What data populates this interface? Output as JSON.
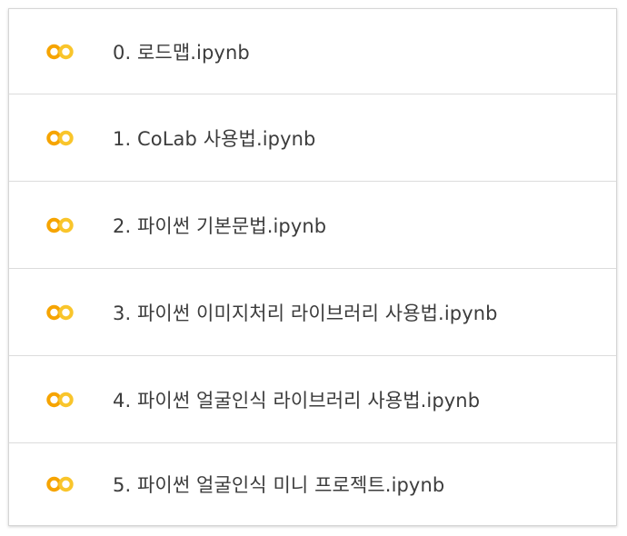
{
  "file_list": {
    "icon": "colab-icon",
    "colors": {
      "icon_orange": "#f6a400",
      "icon_yellow": "#f9c52b",
      "text": "#3c3c3c",
      "divider": "#dcdcdc"
    },
    "items": [
      {
        "name": "0. 로드맵.ipynb"
      },
      {
        "name": "1. CoLab 사용법.ipynb"
      },
      {
        "name": "2. 파이썬 기본문법.ipynb"
      },
      {
        "name": "3. 파이썬 이미지처리 라이브러리 사용법.ipynb"
      },
      {
        "name": "4. 파이썬 얼굴인식 라이브러리 사용법.ipynb"
      },
      {
        "name": "5. 파이썬 얼굴인식 미니 프로젝트.ipynb"
      }
    ]
  }
}
